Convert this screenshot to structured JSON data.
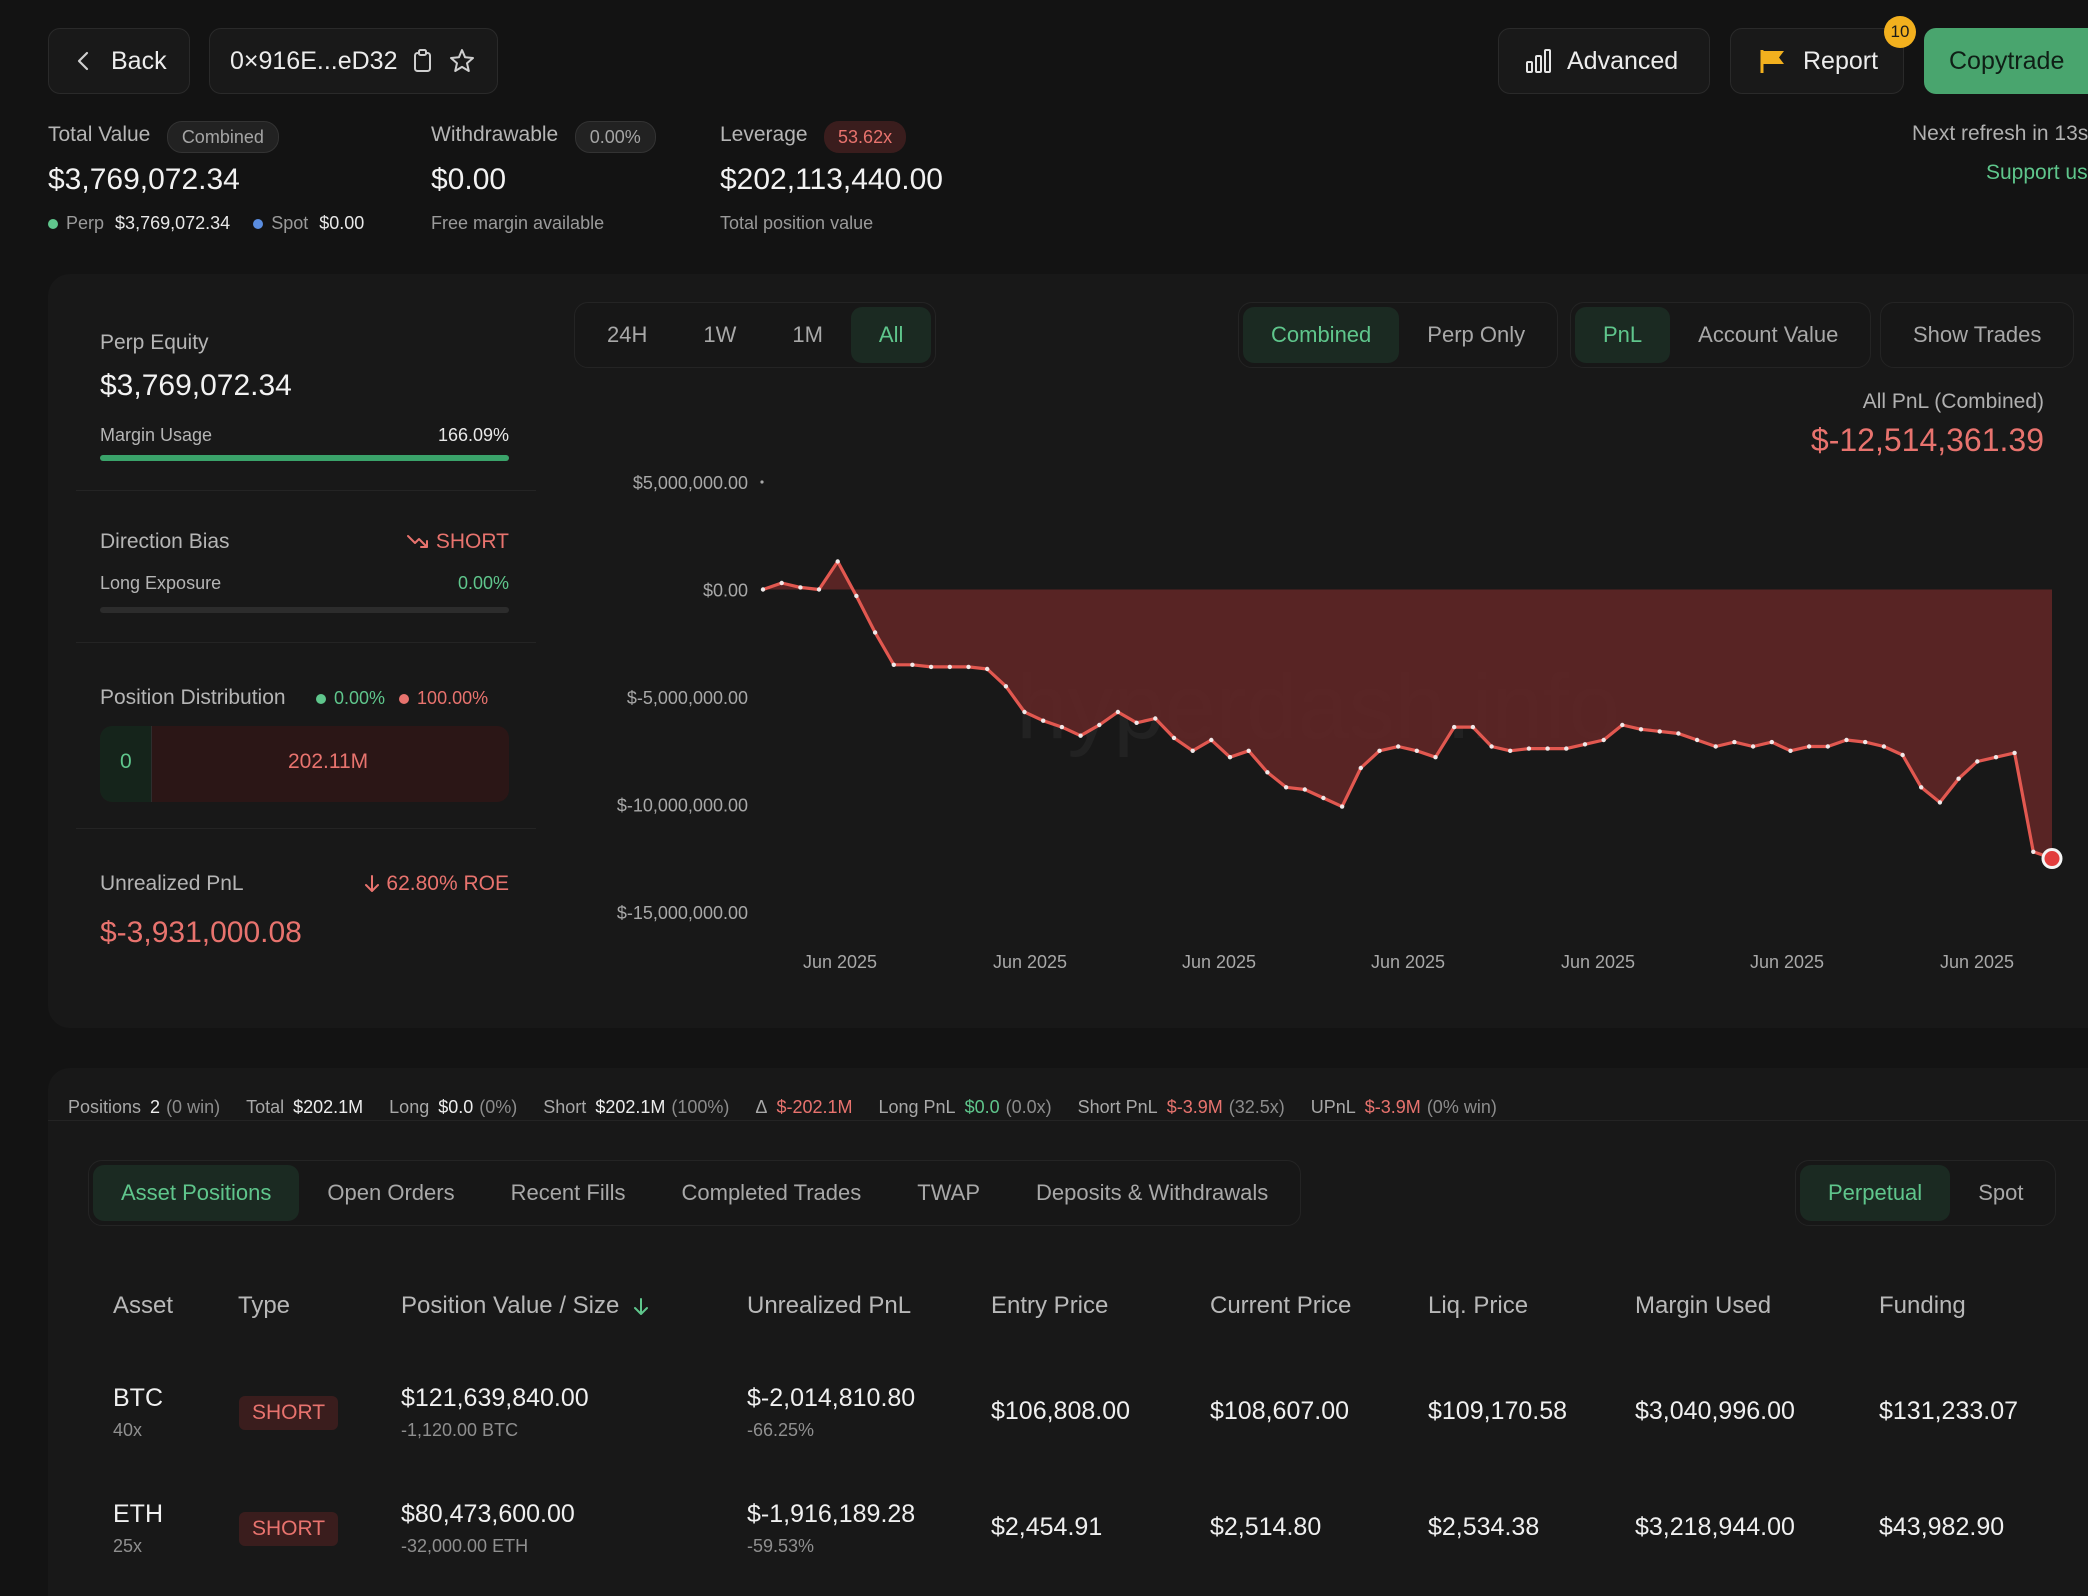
{
  "header": {
    "back_label": "Back",
    "address": "0×916E...eD32",
    "advanced_label": "Advanced",
    "report_label": "Report",
    "report_badge": "10",
    "copytrade_label": "Copytrade",
    "refresh_text": "Next refresh in 13s",
    "support_text": "Support us"
  },
  "summary": {
    "total_value_label": "Total Value",
    "total_value_pill": "Combined",
    "total_value": "$3,769,072.34",
    "perp_label": "Perp",
    "perp_value": "$3,769,072.34",
    "spot_label": "Spot",
    "spot_value": "$0.00",
    "withdrawable_label": "Withdrawable",
    "withdrawable_pill": "0.00%",
    "withdrawable_value": "$0.00",
    "withdrawable_sub": "Free margin available",
    "leverage_label": "Leverage",
    "leverage_pill": "53.62x",
    "leverage_value": "$202,113,440.00",
    "leverage_sub": "Total position value"
  },
  "sidebar": {
    "perp_equity_label": "Perp Equity",
    "perp_equity_value": "$3,769,072.34",
    "margin_usage_label": "Margin Usage",
    "margin_usage_value": "166.09%",
    "margin_usage_fraction": 1.0,
    "direction_bias_label": "Direction Bias",
    "direction_bias_value": "SHORT",
    "long_exposure_label": "Long Exposure",
    "long_exposure_value": "0.00%",
    "position_dist_label": "Position Distribution",
    "dist_long_pct": "0.00%",
    "dist_short_pct": "100.00%",
    "dist_long_value": "0",
    "dist_short_value": "202.11M",
    "unrealized_label": "Unrealized PnL",
    "roe_text": "62.80% ROE",
    "unrealized_value": "$-3,931,000.08"
  },
  "chart_controls": {
    "ranges": [
      "24H",
      "1W",
      "1M",
      "All"
    ],
    "active_range": "All",
    "modes": [
      "Combined",
      "Perp Only"
    ],
    "active_mode": "Combined",
    "metrics": [
      "PnL",
      "Account Value"
    ],
    "active_metric": "PnL",
    "show_trades": "Show Trades",
    "pnl_title": "All PnL (Combined)",
    "pnl_value": "$-12,514,361.39",
    "watermark": "hyperdash.info"
  },
  "chart_data": {
    "type": "area",
    "y_ticks": [
      "$5,000,000.00",
      "$0.00",
      "$-5,000,000.00",
      "$-10,000,000.00",
      "$-15,000,000.00"
    ],
    "x_ticks": [
      "Jun 2025",
      "Jun 2025",
      "Jun 2025",
      "Jun 2025",
      "Jun 2025",
      "Jun 2025",
      "Jun 2025"
    ],
    "ylim": [
      -15000000,
      5000000
    ],
    "color": "#e25850",
    "values": [
      0,
      300000,
      100000,
      0,
      1300000,
      -300000,
      -2000000,
      -3500000,
      -3500000,
      -3600000,
      -3600000,
      -3600000,
      -3700000,
      -4500000,
      -5700000,
      -6100000,
      -6400000,
      -6800000,
      -6300000,
      -5700000,
      -6200000,
      -6000000,
      -6900000,
      -7500000,
      -7000000,
      -7800000,
      -7500000,
      -8500000,
      -9200000,
      -9300000,
      -9700000,
      -10100000,
      -8300000,
      -7500000,
      -7300000,
      -7500000,
      -7800000,
      -6400000,
      -6400000,
      -7300000,
      -7500000,
      -7400000,
      -7400000,
      -7400000,
      -7200000,
      -7000000,
      -6300000,
      -6500000,
      -6600000,
      -6700000,
      -7000000,
      -7300000,
      -7100000,
      -7300000,
      -7100000,
      -7500000,
      -7300000,
      -7300000,
      -7000000,
      -7100000,
      -7300000,
      -7700000,
      -9200000,
      -9900000,
      -8800000,
      -8000000,
      -7800000,
      -7600000,
      -12200000,
      -12500000
    ],
    "end_value": -12514361.39
  },
  "stats": {
    "positions_label": "Positions",
    "positions_value": "2",
    "positions_sub": "(0 win)",
    "total_label": "Total",
    "total_value": "$202.1M",
    "long_label": "Long",
    "long_value": "$0.0",
    "long_sub": "(0%)",
    "short_label": "Short",
    "short_value": "$202.1M",
    "short_sub": "(100%)",
    "delta_label": "Δ",
    "delta_value": "$-202.1M",
    "longpnl_label": "Long PnL",
    "longpnl_value": "$0.0",
    "longpnl_sub": "(0.0x)",
    "shortpnl_label": "Short PnL",
    "shortpnl_value": "$-3.9M",
    "shortpnl_sub": "(32.5x)",
    "upnl_label": "UPnL",
    "upnl_value": "$-3.9M",
    "upnl_sub": "(0% win)"
  },
  "tabs": {
    "items": [
      "Asset Positions",
      "Open Orders",
      "Recent Fills",
      "Completed Trades",
      "TWAP",
      "Deposits & Withdrawals"
    ],
    "active": "Asset Positions",
    "markets": [
      "Perpetual",
      "Spot"
    ],
    "active_market": "Perpetual"
  },
  "table": {
    "headers": [
      "Asset",
      "Type",
      "Position Value / Size",
      "Unrealized PnL",
      "Entry Price",
      "Current Price",
      "Liq. Price",
      "Margin Used",
      "Funding"
    ],
    "rows": [
      {
        "asset": "BTC",
        "lev": "40x",
        "type": "SHORT",
        "value": "$121,639,840.00",
        "size": "-1,120.00 BTC",
        "pnl": "$-2,014,810.80",
        "pnl_pct": "-66.25%",
        "entry": "$106,808.00",
        "current": "$108,607.00",
        "liq": "$109,170.58",
        "margin": "$3,040,996.00",
        "funding": "$131,233.07"
      },
      {
        "asset": "ETH",
        "lev": "25x",
        "type": "SHORT",
        "value": "$80,473,600.00",
        "size": "-32,000.00 ETH",
        "pnl": "$-1,916,189.28",
        "pnl_pct": "-59.53%",
        "entry": "$2,454.91",
        "current": "$2,514.80",
        "liq": "$2,534.38",
        "margin": "$3,218,944.00",
        "funding": "$43,982.90"
      }
    ]
  }
}
